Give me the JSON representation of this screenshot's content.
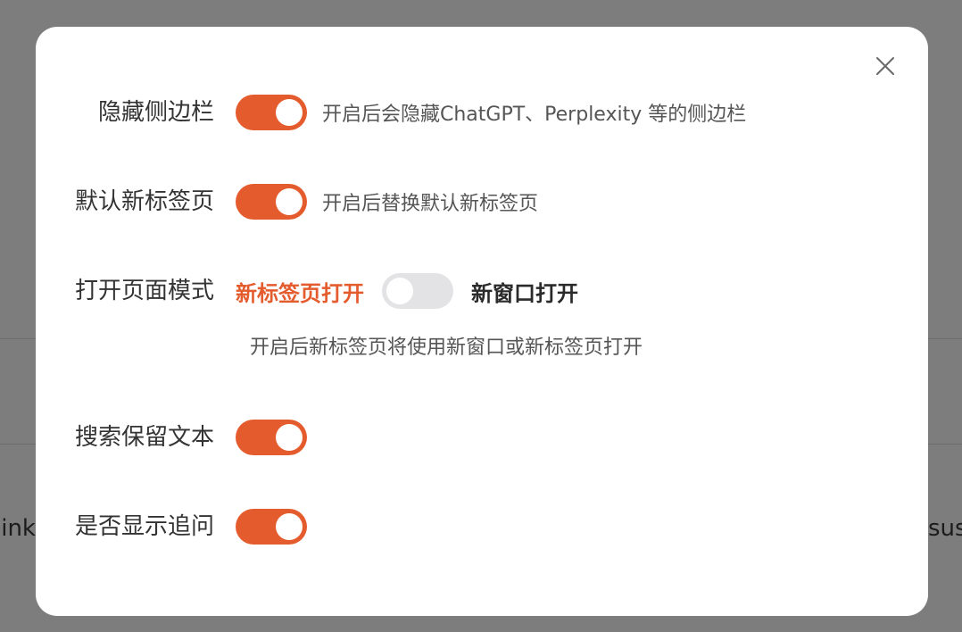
{
  "background": {
    "left_fragment": "hink",
    "right_fragment": "sus"
  },
  "dialog": {
    "close_icon": "close-icon",
    "accent_color": "#e45c2e",
    "settings": [
      {
        "label": "隐藏侧边栏",
        "enabled": true,
        "description": "开启后会隐藏ChatGPT、Perplexity 等的侧边栏"
      },
      {
        "label": "默认新标签页",
        "enabled": true,
        "description": "开启后替换默认新标签页"
      },
      {
        "label": "打开页面模式",
        "enabled": false,
        "option_off": "新标签页打开",
        "option_on": "新窗口打开",
        "hint": "开启后新标签页将使用新窗口或新标签页打开"
      },
      {
        "label": "搜索保留文本",
        "enabled": true
      },
      {
        "label": "是否显示追问",
        "enabled": true
      }
    ]
  }
}
